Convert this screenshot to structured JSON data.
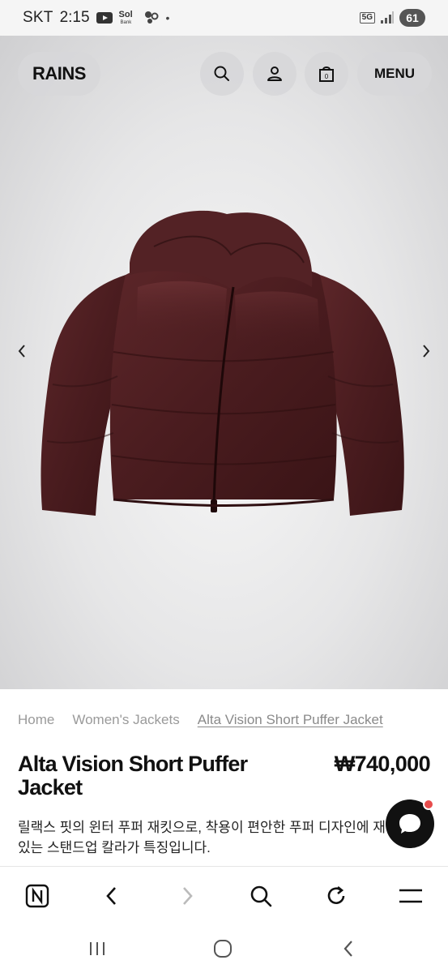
{
  "status_bar": {
    "carrier": "SKT",
    "time": "2:15",
    "bank_label": "Sol",
    "bank_sub": "Bank",
    "network": "5G",
    "battery": "61"
  },
  "header": {
    "logo": "RAINS",
    "menu_label": "MENU",
    "icons": [
      "search-icon",
      "account-icon",
      "bag-icon"
    ]
  },
  "breadcrumb": [
    "Home",
    "Women's Jackets",
    "Alta Vision Short Puffer Jacket"
  ],
  "product": {
    "title": "Alta Vision Short Puffer Jacket",
    "price": "₩740,000",
    "description": "릴랙스 핏의 윈터 푸퍼 재킷으로, 착용이 편안한 푸퍼 디자인에 재감 있는 스탠드업 칼라가 특징입니다."
  },
  "colors": {
    "jacket": "#4a1c1f",
    "hero_bg": "#e6e6e7",
    "chat_button": "#111111",
    "chat_badge": "#e74c4c"
  },
  "browser_toolbar": {
    "icons": [
      "n-home-icon",
      "back-icon",
      "forward-icon",
      "search-icon",
      "refresh-icon",
      "menu-icon"
    ]
  },
  "system_nav": {
    "icons": [
      "recents-icon",
      "home-icon",
      "back-icon"
    ]
  }
}
